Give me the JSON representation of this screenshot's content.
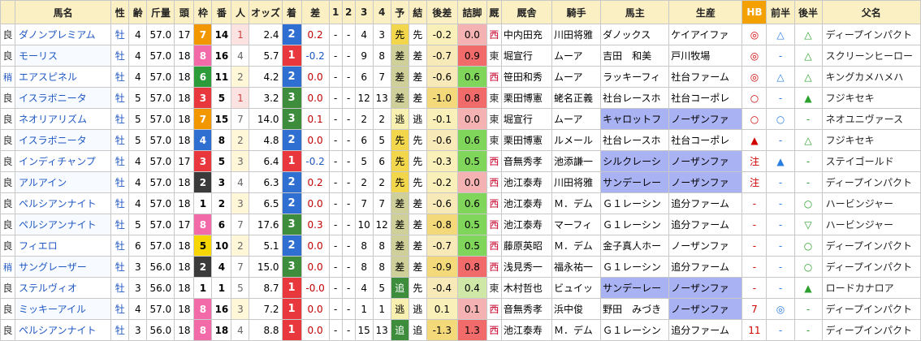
{
  "headers": [
    "馬名",
    "性",
    "齢",
    "斤量",
    "頭",
    "枠",
    "番",
    "人",
    "オッズ",
    "着",
    "差",
    "1",
    "2",
    "3",
    "4",
    "予",
    "結",
    "後差",
    "詰脚",
    "厩",
    "厩舎",
    "騎手",
    "馬主",
    "生産",
    "HB",
    "前半",
    "後半",
    "父名"
  ],
  "colors": {
    "frame": {
      "1": "#ffffff",
      "2": "#3a3a3a",
      "3": "#e8383d",
      "4": "#2f6fd1",
      "5": "#f7d500",
      "6": "#2e9b3a",
      "7": "#f39700",
      "8": "#f26aa8"
    },
    "finish": {
      "1": "#e8383d",
      "2": "#2f6fd1",
      "3": "#3d8d3d"
    },
    "pred_colors": {
      "先": "#f2d64b",
      "差": "#cfcf9a",
      "逃": "#f7f0b0",
      "追": "#3d8d3d"
    },
    "late_colors": {
      "high": "#f26b6b",
      "mid": "#f4b2b2",
      "low": "#cfe8a8",
      "vlow": "#7fd65a"
    }
  },
  "rows": [
    {
      "state": "良",
      "horse": "ダノンプレミアム",
      "sex": "牡",
      "age": "4",
      "weight": "57.0",
      "heads": "17",
      "frame": "7",
      "num": "14",
      "pop": "1",
      "odds": "2.4",
      "finish": "2",
      "diff": "0.2",
      "c1": "-",
      "c2": "-",
      "c3": "4",
      "c4": "3",
      "pred": "先",
      "res": "先",
      "late": "-0.2",
      "kyakushitsu": "0.0",
      "region": "西",
      "trainer": "中内田充",
      "jockey": "川田将雅",
      "owner": "ダノックス",
      "breeder": "ケイアイファ",
      "hb": "◎",
      "fh": "△",
      "lh": "△",
      "sire": "ディープインパクト"
    },
    {
      "state": "良",
      "horse": "モーリス",
      "sex": "牡",
      "age": "4",
      "weight": "57.0",
      "heads": "18",
      "frame": "8",
      "num": "16",
      "pop": "4",
      "odds": "5.7",
      "finish": "1",
      "diff": "-0.2",
      "c1": "-",
      "c2": "-",
      "c3": "9",
      "c4": "8",
      "pred": "差",
      "res": "差",
      "late": "-0.7",
      "kyakushitsu": "0.9",
      "region": "東",
      "trainer": "堀宣行",
      "jockey": "ムーア",
      "owner": "吉田　和美",
      "breeder": "戸川牧場",
      "hb": "◎",
      "fh": "-",
      "lh": "△",
      "sire": "スクリーンヒーロー"
    },
    {
      "state": "稍",
      "horse": "エアスピネル",
      "sex": "牡",
      "age": "4",
      "weight": "57.0",
      "heads": "18",
      "frame": "6",
      "num": "11",
      "pop": "2",
      "odds": "4.2",
      "finish": "2",
      "diff": "0.0",
      "c1": "-",
      "c2": "-",
      "c3": "6",
      "c4": "7",
      "pred": "差",
      "res": "差",
      "late": "-0.6",
      "kyakushitsu": "0.6",
      "region": "西",
      "trainer": "笹田和秀",
      "jockey": "ムーア",
      "owner": "ラッキーフィ",
      "breeder": "社台ファーム",
      "hb": "◎",
      "fh": "△",
      "lh": "△",
      "sire": "キングカメハメハ"
    },
    {
      "state": "良",
      "horse": "イスラボニータ",
      "sex": "牡",
      "age": "5",
      "weight": "57.0",
      "heads": "18",
      "frame": "3",
      "num": "5",
      "pop": "1",
      "odds": "3.2",
      "finish": "3",
      "diff": "0.0",
      "c1": "-",
      "c2": "-",
      "c3": "12",
      "c4": "13",
      "pred": "差",
      "res": "差",
      "late": "-1.0",
      "kyakushitsu": "0.8",
      "region": "東",
      "trainer": "栗田博憲",
      "jockey": "蛯名正義",
      "owner": "社台レースホ",
      "breeder": "社台コーポレ",
      "hb": "○",
      "fh": "-",
      "lh": "▲",
      "sire": "フジキセキ"
    },
    {
      "state": "良",
      "horse": "ネオリアリズム",
      "sex": "牡",
      "age": "5",
      "weight": "57.0",
      "heads": "18",
      "frame": "7",
      "num": "15",
      "pop": "7",
      "odds": "14.0",
      "finish": "3",
      "diff": "0.1",
      "c1": "-",
      "c2": "-",
      "c3": "2",
      "c4": "2",
      "pred": "逃",
      "res": "逃",
      "late": "-0.1",
      "kyakushitsu": "0.0",
      "region": "東",
      "trainer": "堀宣行",
      "jockey": "ムーア",
      "owner": "キャロットフ",
      "breeder": "ノーザンファ",
      "hb": "○",
      "fh": "○",
      "lh": "-",
      "sire": "ネオユニヴァース",
      "hl": true
    },
    {
      "state": "良",
      "horse": "イスラボニータ",
      "sex": "牡",
      "age": "5",
      "weight": "57.0",
      "heads": "18",
      "frame": "4",
      "num": "8",
      "pop": "2",
      "odds": "4.8",
      "finish": "2",
      "diff": "0.0",
      "c1": "-",
      "c2": "-",
      "c3": "6",
      "c4": "5",
      "pred": "先",
      "res": "先",
      "late": "-0.6",
      "kyakushitsu": "0.6",
      "region": "東",
      "trainer": "栗田博憲",
      "jockey": "ルメール",
      "owner": "社台レースホ",
      "breeder": "社台コーポレ",
      "hb": "▲",
      "fh": "-",
      "lh": "△",
      "sire": "フジキセキ"
    },
    {
      "state": "良",
      "horse": "インディチャンプ",
      "sex": "牡",
      "age": "4",
      "weight": "57.0",
      "heads": "17",
      "frame": "3",
      "num": "5",
      "pop": "3",
      "odds": "6.4",
      "finish": "1",
      "diff": "-0.2",
      "c1": "-",
      "c2": "-",
      "c3": "5",
      "c4": "6",
      "pred": "先",
      "res": "先",
      "late": "-0.3",
      "kyakushitsu": "0.5",
      "region": "西",
      "trainer": "音無秀孝",
      "jockey": "池添謙一",
      "owner": "シルクレーシ",
      "breeder": "ノーザンファ",
      "hb": "注",
      "fh": "▲",
      "lh": "-",
      "sire": "ステイゴールド",
      "hl": true
    },
    {
      "state": "良",
      "horse": "アルアイン",
      "sex": "牡",
      "age": "4",
      "weight": "57.0",
      "heads": "18",
      "frame": "2",
      "num": "3",
      "pop": "4",
      "odds": "6.3",
      "finish": "2",
      "diff": "0.2",
      "c1": "-",
      "c2": "-",
      "c3": "2",
      "c4": "2",
      "pred": "先",
      "res": "先",
      "late": "-0.2",
      "kyakushitsu": "0.0",
      "region": "西",
      "trainer": "池江泰寿",
      "jockey": "川田将雅",
      "owner": "サンデーレー",
      "breeder": "ノーザンファ",
      "hb": "注",
      "fh": "-",
      "lh": "-",
      "sire": "ディープインパクト",
      "hl": true
    },
    {
      "state": "良",
      "horse": "ペルシアンナイト",
      "sex": "牡",
      "age": "4",
      "weight": "57.0",
      "heads": "18",
      "frame": "1",
      "num": "2",
      "pop": "3",
      "odds": "6.5",
      "finish": "2",
      "diff": "0.0",
      "c1": "-",
      "c2": "-",
      "c3": "7",
      "c4": "7",
      "pred": "差",
      "res": "差",
      "late": "-0.6",
      "kyakushitsu": "0.6",
      "region": "西",
      "trainer": "池江泰寿",
      "jockey": "Ｍ．デム",
      "owner": "Ｇ１レーシン",
      "breeder": "追分ファーム",
      "hb": "-",
      "fh": "-",
      "lh": "○",
      "sire": "ハービンジャー"
    },
    {
      "state": "良",
      "horse": "ペルシアンナイト",
      "sex": "牡",
      "age": "5",
      "weight": "57.0",
      "heads": "17",
      "frame": "8",
      "num": "6",
      "pop": "7",
      "odds": "17.6",
      "finish": "3",
      "diff": "0.3",
      "c1": "-",
      "c2": "-",
      "c3": "10",
      "c4": "12",
      "pred": "差",
      "res": "差",
      "late": "-0.8",
      "kyakushitsu": "0.5",
      "region": "西",
      "trainer": "池江泰寿",
      "jockey": "マーフィ",
      "owner": "Ｇ１レーシン",
      "breeder": "追分ファーム",
      "hb": "-",
      "fh": "-",
      "lh": "▽",
      "sire": "ハービンジャー"
    },
    {
      "state": "良",
      "horse": "フィエロ",
      "sex": "牡",
      "age": "6",
      "weight": "57.0",
      "heads": "18",
      "frame": "5",
      "num": "10",
      "pop": "2",
      "odds": "5.1",
      "finish": "2",
      "diff": "0.0",
      "c1": "-",
      "c2": "-",
      "c3": "8",
      "c4": "8",
      "pred": "差",
      "res": "差",
      "late": "-0.7",
      "kyakushitsu": "0.5",
      "region": "西",
      "trainer": "藤原英昭",
      "jockey": "Ｍ．デム",
      "owner": "金子真人ホー",
      "breeder": "ノーザンファ",
      "hb": "-",
      "fh": "-",
      "lh": "○",
      "sire": "ディープインパクト"
    },
    {
      "state": "稍",
      "horse": "サングレーザー",
      "sex": "牡",
      "age": "3",
      "weight": "56.0",
      "heads": "18",
      "frame": "2",
      "num": "4",
      "pop": "7",
      "odds": "15.0",
      "finish": "3",
      "diff": "0.0",
      "c1": "-",
      "c2": "-",
      "c3": "8",
      "c4": "8",
      "pred": "差",
      "res": "差",
      "late": "-0.9",
      "kyakushitsu": "0.8",
      "region": "西",
      "trainer": "浅見秀一",
      "jockey": "福永祐一",
      "owner": "Ｇ１レーシン",
      "breeder": "追分ファーム",
      "hb": "-",
      "fh": "-",
      "lh": "○",
      "sire": "ディープインパクト"
    },
    {
      "state": "良",
      "horse": "ステルヴィオ",
      "sex": "牡",
      "age": "3",
      "weight": "56.0",
      "heads": "18",
      "frame": "1",
      "num": "1",
      "pop": "5",
      "odds": "8.7",
      "finish": "1",
      "diff": "-0.0",
      "c1": "-",
      "c2": "-",
      "c3": "4",
      "c4": "5",
      "pred": "追",
      "res": "先",
      "late": "-0.4",
      "kyakushitsu": "0.4",
      "region": "東",
      "trainer": "木村哲也",
      "jockey": "ビュイッ",
      "owner": "サンデーレー",
      "breeder": "ノーザンファ",
      "hb": "-",
      "fh": "-",
      "lh": "▲",
      "sire": "ロードカナロア",
      "hl": true
    },
    {
      "state": "良",
      "horse": "ミッキーアイル",
      "sex": "牡",
      "age": "4",
      "weight": "57.0",
      "heads": "18",
      "frame": "8",
      "num": "16",
      "pop": "3",
      "odds": "7.2",
      "finish": "1",
      "diff": "0.0",
      "c1": "-",
      "c2": "-",
      "c3": "1",
      "c4": "1",
      "pred": "逃",
      "res": "逃",
      "late": "0.1",
      "kyakushitsu": "0.1",
      "region": "西",
      "trainer": "音無秀孝",
      "jockey": "浜中俊",
      "owner": "野田　みづき",
      "breeder": "ノーザンファ",
      "hb": "7",
      "fh": "◎",
      "lh": "-",
      "sire": "ディープインパクト",
      "hl2": true
    },
    {
      "state": "良",
      "horse": "ペルシアンナイト",
      "sex": "牡",
      "age": "3",
      "weight": "56.0",
      "heads": "18",
      "frame": "8",
      "num": "18",
      "pop": "4",
      "odds": "8.8",
      "finish": "1",
      "diff": "0.0",
      "c1": "-",
      "c2": "-",
      "c3": "15",
      "c4": "13",
      "pred": "追",
      "res": "追",
      "late": "-1.3",
      "kyakushitsu": "1.3",
      "region": "西",
      "trainer": "池江泰寿",
      "jockey": "Ｍ．デム",
      "owner": "Ｇ１レーシン",
      "breeder": "追分ファーム",
      "hb": "11",
      "fh": "-",
      "lh": "-",
      "sire": "ディープインパクト"
    }
  ]
}
